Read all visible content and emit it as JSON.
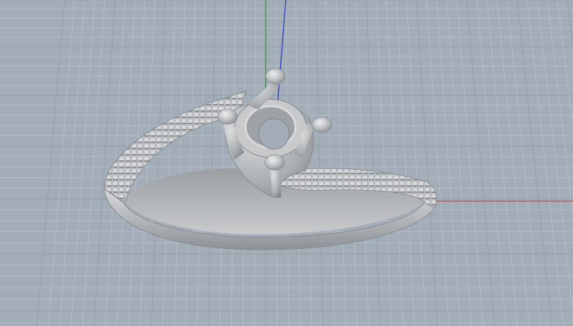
{
  "viewport": {
    "view": "perspective",
    "background_color": "#a3adb7",
    "grid_minor_color": "#b6bec7",
    "grid_major_color": "#959ea8",
    "axis_x_color": "#c8584a",
    "axis_y_color": "#3f9a3f",
    "axis_z_color": "#3a45c8"
  },
  "model": {
    "name": "solitaire-ring-with-4-prong-head",
    "material_color": "#b9bcbf",
    "prongs": 4,
    "shank_style": "bypass",
    "shank_texture": "pave-ridged"
  }
}
